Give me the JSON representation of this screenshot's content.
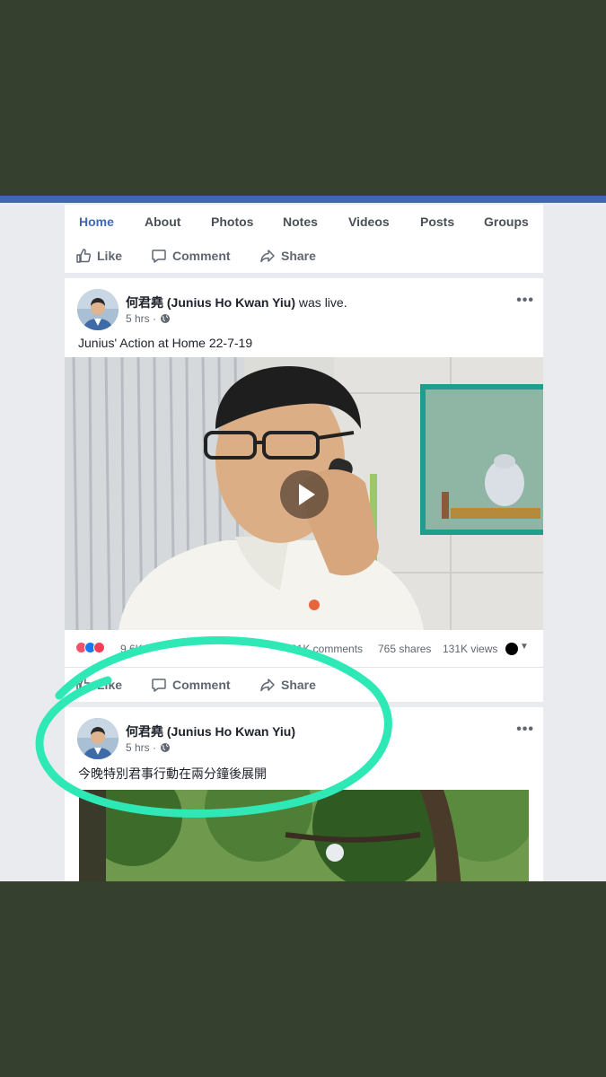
{
  "nav": {
    "tabs": [
      {
        "label": "Home",
        "active": true
      },
      {
        "label": "About"
      },
      {
        "label": "Photos"
      },
      {
        "label": "Notes"
      },
      {
        "label": "Videos"
      },
      {
        "label": "Posts"
      },
      {
        "label": "Groups"
      }
    ]
  },
  "actions": {
    "like": "Like",
    "comment": "Comment",
    "share": "Share"
  },
  "posts": [
    {
      "author": "何君堯 (Junius Ho Kwan Yiu)",
      "suffix": " was live.",
      "time": "5 hrs · ",
      "text": "Junius' Action at Home 22-7-19",
      "stats": {
        "reaction_count": "9.6K",
        "comments": "21K comments",
        "shares": "765 shares",
        "views": "131K views"
      }
    },
    {
      "author": "何君堯 (Junius Ho Kwan Yiu)",
      "time": "5 hrs · ",
      "text": "今晚特別君事行動在兩分鐘後展開"
    }
  ],
  "icons": {
    "like": "thumbs-up-icon",
    "comment": "speech-bubble-icon",
    "share": "share-arrow-icon",
    "privacy": "globe-icon",
    "more": "more-dots-icon",
    "play": "play-icon"
  },
  "colors": {
    "brand": "#4267b2",
    "highlight_circle": "#2ee8b6",
    "backdrop": "#35402e"
  }
}
